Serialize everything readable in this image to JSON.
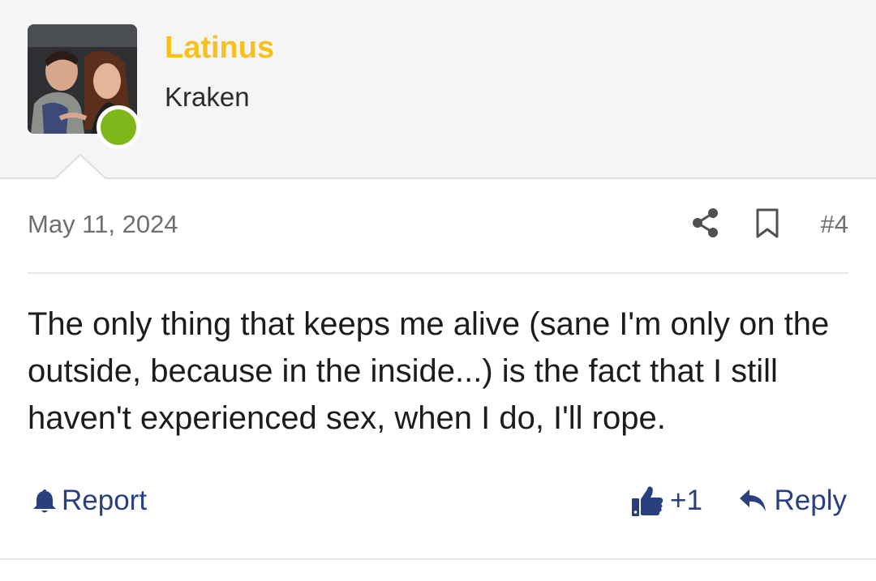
{
  "user": {
    "username": "Latinus",
    "title": "Kraken",
    "online": true
  },
  "post": {
    "date": "May 11, 2024",
    "number": "#4",
    "message": "The only thing that keeps me alive (sane I'm only on the outside, because in the inside...) is the fact that I still haven't experienced sex, when I do, I'll rope."
  },
  "actions": {
    "report_label": "Report",
    "like_count": "+1",
    "reply_label": "Reply"
  },
  "icons": {
    "share": "share-icon",
    "bookmark": "bookmark-icon",
    "report": "bell-icon",
    "like": "thumbs-up-icon",
    "reply": "reply-arrow-icon"
  },
  "colors": {
    "username": "#f7c01b",
    "online": "#7fb61a",
    "link": "#2a3f7e",
    "meta": "#6f6f6f",
    "header_bg": "#f5f5f5"
  }
}
